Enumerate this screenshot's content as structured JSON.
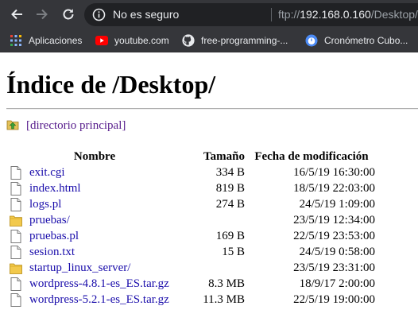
{
  "browser": {
    "security_label": "No es seguro",
    "url": {
      "scheme": "ftp://",
      "host": "192.168.0.160",
      "path": "/Desktop/"
    },
    "bookmarks": [
      {
        "label": "Aplicaciones",
        "icon": "apps-grid-icon"
      },
      {
        "label": "youtube.com",
        "icon": "youtube-icon"
      },
      {
        "label": "free-programming-...",
        "icon": "github-icon"
      },
      {
        "label": "Cronómetro Cubo...",
        "icon": "stopwatch-icon"
      }
    ]
  },
  "page": {
    "title": "Índice de /Desktop/",
    "parent_link": "[directorio principal]",
    "table": {
      "headers": {
        "name": "Nombre",
        "size": "Tamaño",
        "date": "Fecha de modificación"
      },
      "rows": [
        {
          "type": "file",
          "name": "exit.cgi",
          "size": "334 B",
          "date": "16/5/19 16:30:00"
        },
        {
          "type": "file",
          "name": "index.html",
          "size": "819 B",
          "date": "18/5/19 22:03:00"
        },
        {
          "type": "file",
          "name": "logs.pl",
          "size": "274 B",
          "date": "24/5/19 1:09:00"
        },
        {
          "type": "folder",
          "name": "pruebas/",
          "size": "",
          "date": "23/5/19 12:34:00"
        },
        {
          "type": "file",
          "name": "pruebas.pl",
          "size": "169 B",
          "date": "22/5/19 23:53:00"
        },
        {
          "type": "file",
          "name": "sesion.txt",
          "size": "15 B",
          "date": "24/5/19 0:58:00"
        },
        {
          "type": "folder",
          "name": "startup_linux_server/",
          "size": "",
          "date": "23/5/19 23:31:00"
        },
        {
          "type": "file",
          "name": "wordpress-4.8.1-es_ES.tar.gz",
          "size": "8.3 MB",
          "date": "18/9/17 2:00:00"
        },
        {
          "type": "file",
          "name": "wordpress-5.2.1-es_ES.tar.gz",
          "size": "11.3 MB",
          "date": "22/5/19 19:00:00"
        }
      ]
    }
  }
}
